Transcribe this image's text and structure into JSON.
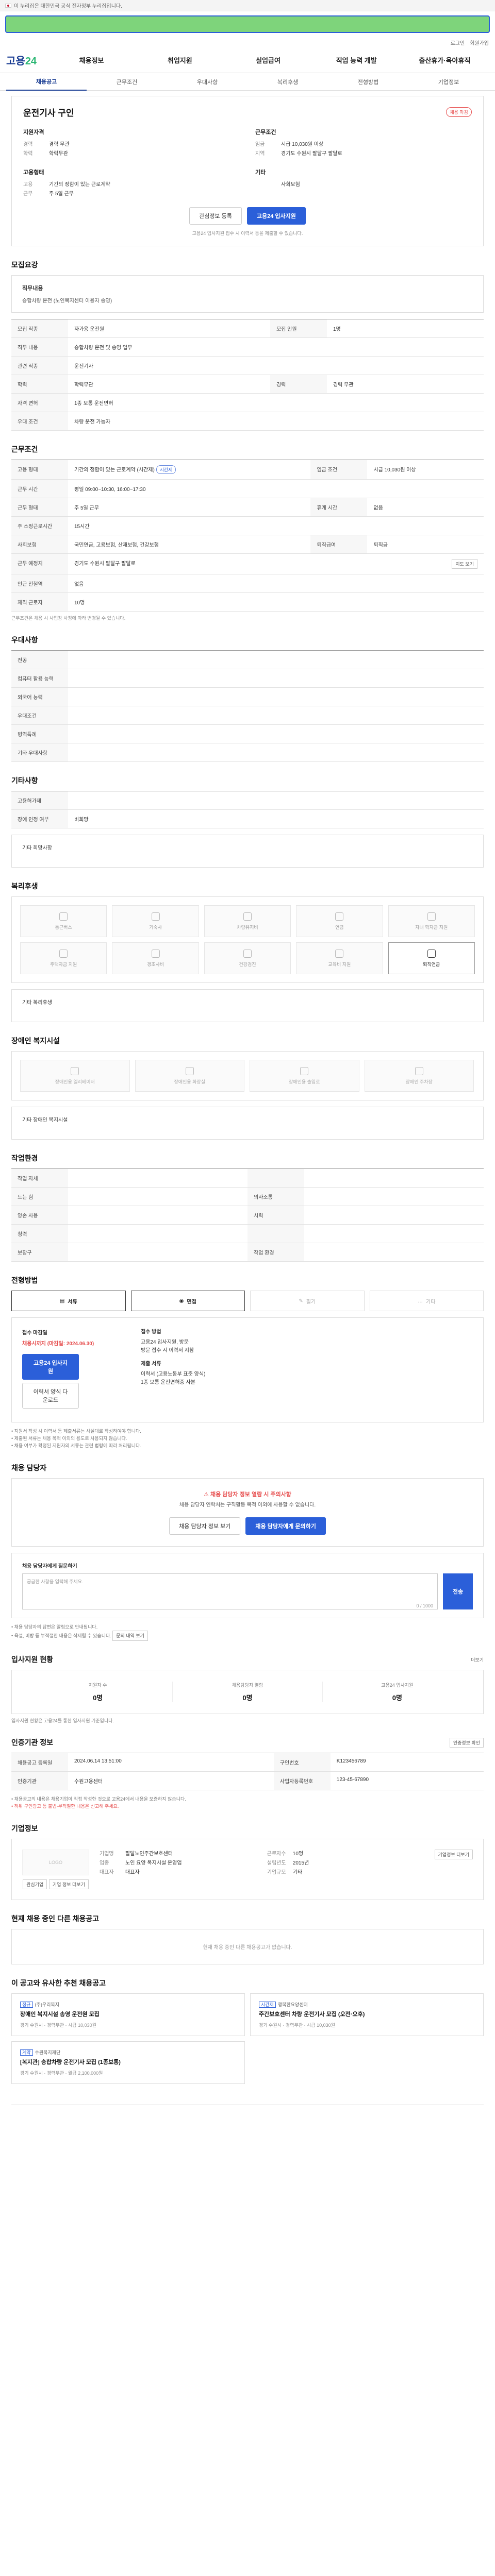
{
  "gov_bar": {
    "text": "이 누리집은 대한민국 공식 전자정부 누리집입니다."
  },
  "header": {
    "util": [
      "로그인",
      "회원가입"
    ],
    "logo_main": "고용",
    "logo_accent": "24",
    "gnb": [
      "채용정보",
      "취업지원",
      "실업급여",
      "직업 능력 개발",
      "출산휴가·육아휴직"
    ]
  },
  "tabs": [
    "채용공고",
    "근무조건",
    "우대사항",
    "복리후생",
    "전형방법",
    "기업정보"
  ],
  "job": {
    "title": "운전기사 구인",
    "badge": "채용 마감",
    "applicant_head": "지원자격",
    "applicant": [
      {
        "k": "경력",
        "v": "경력 무관"
      },
      {
        "k": "학력",
        "v": "학력무관"
      }
    ],
    "cond_head": "근무조건",
    "cond": [
      {
        "k": "임금",
        "v": "시급 10,030원 이상"
      },
      {
        "k": "지역",
        "v": "경기도 수원시 팔달구 팔달로"
      }
    ],
    "emp_head": "고용형태",
    "emp": [
      {
        "k": "고용",
        "v": "기간의 정함이 있는 근로계약"
      },
      {
        "k": "근무",
        "v": "주 5일 근무"
      }
    ],
    "etc_head": "기타",
    "etc": [
      {
        "k": "",
        "v": "사회보험"
      }
    ],
    "btn_bookmark": "관심정보 등록",
    "btn_apply": "고용24 입사지원",
    "note": "고용24 입사지원 접수 시 이력서 등을 제출할 수 있습니다."
  },
  "duties": {
    "title": "모집요강",
    "box_head": "직무내용",
    "box_text": "승합차량 운전 (노인복지센터 이용자 송영)",
    "rows": [
      {
        "k": "모집 직종",
        "v": "자가용 운전원"
      },
      {
        "k": "모집 인원",
        "v": "1명"
      },
      {
        "k": "직무 내용",
        "v": "승합차량 운전 및 송영 업무"
      },
      {
        "k": "관련 직종",
        "v": "운전기사"
      },
      {
        "k": "학력",
        "v": "학력무관"
      },
      {
        "k": "경력",
        "v": "경력 무관"
      },
      {
        "k": "자격 면허",
        "v": "1종 보통 운전면허"
      },
      {
        "k": "우대 조건",
        "v": "차량 운전 가능자"
      }
    ]
  },
  "work": {
    "title": "근무조건",
    "rows": [
      {
        "k": "고용 형태",
        "v": "기간의 정함이 있는 근로계약 (시간제)"
      },
      {
        "k": "임금 조건",
        "v": "시급 10,030원 이상"
      },
      {
        "k": "근무 시간",
        "v": "평일 09:00~10:30, 16:00~17:30"
      },
      {
        "k": "근무 형태",
        "v": "주 5일 근무"
      },
      {
        "k": "휴게 시간",
        "v": "없음"
      },
      {
        "k": "주 소정근로시간",
        "v": "15시간"
      },
      {
        "k": "사회보험",
        "v": "국민연금, 고용보험, 산재보험, 건강보험"
      },
      {
        "k": "퇴직급여",
        "v": "퇴직금"
      },
      {
        "k": "근무 예정지",
        "v": "경기도 수원시 팔달구 팔달로"
      },
      {
        "k": "인근 전철역",
        "v": "없음"
      },
      {
        "k": "재직 근로자",
        "v": "10명"
      }
    ],
    "pill": "시간제",
    "map_btn": "지도 보기",
    "note": "근무조건은 채용 시 사업장 사정에 따라 변경될 수 있습니다."
  },
  "prefer": {
    "title": "우대사항",
    "rows": [
      {
        "k": "전공",
        "v": ""
      },
      {
        "k": "컴퓨터 활용 능력",
        "v": ""
      },
      {
        "k": "외국어 능력",
        "v": ""
      },
      {
        "k": "우대조건",
        "v": ""
      },
      {
        "k": "병역특례",
        "v": ""
      },
      {
        "k": "기타 우대사항",
        "v": ""
      }
    ]
  },
  "other": {
    "title": "기타사항",
    "rows": [
      {
        "k": "고용허가제",
        "v": ""
      },
      {
        "k": "장애 인정 여부",
        "v": "비희망"
      }
    ],
    "etc_label": "기타 희망사항"
  },
  "welfare": {
    "title": "복리후생",
    "items": [
      "통근버스",
      "기숙사",
      "차량유지비",
      "연금",
      "자녀 학자금 지원",
      "주택자금 지원",
      "경조사비",
      "건강검진",
      "교육비 지원",
      "퇴직연금"
    ],
    "on_index": 9,
    "etc_label": "기타 복리후생"
  },
  "disabled": {
    "title": "장애인 복지시설",
    "items": [
      "장애인용 엘리베이터",
      "장애인용 화장실",
      "장애인용 출입로",
      "장애인 주차장"
    ],
    "etc_label": "기타 장애인 복지시설"
  },
  "env": {
    "title": "작업환경",
    "rows": [
      {
        "k": "작업 자세",
        "v": "",
        "k2": "",
        "v2": ""
      },
      {
        "k": "드는 힘",
        "v": "",
        "k2": "의사소통",
        "v2": ""
      },
      {
        "k": "양손 사용",
        "v": "",
        "k2": "시력",
        "v2": ""
      },
      {
        "k": "청력",
        "v": "",
        "k2": "",
        "v2": ""
      },
      {
        "k": "보장구",
        "v": "",
        "k2": "작업 환경",
        "v2": ""
      }
    ]
  },
  "method": {
    "title": "전형방법",
    "items": [
      "서류",
      "면접",
      "필기",
      "기타"
    ],
    "on": [
      true,
      true,
      false,
      false
    ],
    "deadline_head": "접수 마감일",
    "deadline": "채용시까지 (마감일: 2024.06.30)",
    "apply_head": "접수 방법",
    "apply_lines": [
      "고용24 입사지원, 방문",
      "방문 접수 시 이력서 지참"
    ],
    "docs_head": "제출 서류",
    "docs_lines": [
      "이력서 (고용노동부 표준 양식)",
      "1종 보통 운전면허증 사본"
    ],
    "btn_apply": "고용24 입사지원",
    "btn_resume": "이력서 양식 다운로드",
    "bullets": [
      "지원서 작성 시 이력서 등 제출서류는 사실대로 작성하여야 합니다.",
      "제출된 서류는 채용 목적 이외의 용도로 사용되지 않습니다.",
      "채용 여부가 확정된 지원자의 서류는 관련 법령에 따라 처리됩니다."
    ]
  },
  "contact": {
    "title": "채용 담당자",
    "alert": "채용 담당자 정보 열람 시 주의사항",
    "text": "채용 담당자 연락처는 구직활동 목적 이외에 사용할 수 없습니다.",
    "btn_a": "채용 담당자 정보 보기",
    "btn_b": "채용 담당자에게 문의하기",
    "inq_head": "채용 담당자에게 질문하기",
    "inq_placeholder": "궁금한 사항을 입력해 주세요.",
    "inq_count": "0 / 1000",
    "send": "전송",
    "bullets": [
      "채용 담당자의 답변은 알림으로 안내됩니다.",
      "욕설, 비방 등 부적절한 내용은 삭제될 수 있습니다."
    ],
    "mini": "문의 내역 보기"
  },
  "stats": {
    "title": "입사지원 현황",
    "more": "더보기",
    "items": [
      {
        "l": "지원자 수",
        "n": "0명"
      },
      {
        "l": "채용담당자 열람",
        "n": "0명"
      },
      {
        "l": "고용24 입사지원",
        "n": "0명"
      }
    ],
    "note": "입사지원 현황은 고용24를 통한 입사지원 기준입니다."
  },
  "meta": {
    "title": "인증기관 정보",
    "btn": "인증정보 확인",
    "rows": [
      {
        "k": "채용공고 등록일",
        "v": "2024.06.14 13:51:00",
        "k2": "구인번호",
        "v2": "K123456789"
      },
      {
        "k": "인증기관",
        "v": "수원고용센터",
        "k2": "사업자등록번호",
        "v2": "123-45-67890"
      }
    ],
    "notes": [
      "채용공고의 내용은 채용기업이 직접 작성한 것으로 고용24에서 내용을 보증하지 않습니다.",
      "허위 구인광고 등 불법·부적절한 내용은 신고해 주세요."
    ]
  },
  "company": {
    "title": "기업정보",
    "logo_text": "LOGO",
    "btn_a": "관심기업",
    "btn_b": "기업 정보 더보기",
    "rows_a": [
      {
        "k": "기업명",
        "v": "팔달노인주간보호센터"
      },
      {
        "k": "업종",
        "v": "노인 요양 복지시설 운영업"
      },
      {
        "k": "대표자",
        "v": "대표자"
      }
    ],
    "rows_b": [
      {
        "k": "근로자수",
        "v": "10명"
      },
      {
        "k": "설립년도",
        "v": "2015년"
      },
      {
        "k": "기업규모",
        "v": "기타"
      }
    ],
    "more": "기업정보 더보기"
  },
  "similar": {
    "title": "현재 채용 중인 다른 채용공고",
    "empty": "현재 채용 중인 다른 채용공고가 없습니다."
  },
  "rec": {
    "title": "이 공고와 유사한 추천 채용공고",
    "items": [
      {
        "co": "(주)우리복지",
        "tag": "정규",
        "t": "장애인 복지시설 송영 운전원 모집",
        "m": "경기 수원시 · 경력무관 · 시급 10,030원"
      },
      {
        "co": "행복한요양센터",
        "tag": "시간제",
        "t": "주간보호센터 차량 운전기사 모집 (오전·오후)",
        "m": "경기 수원시 · 경력무관 · 시급 10,030원"
      },
      {
        "co": "수원복지재단",
        "tag": "계약",
        "t": "[복지관] 승합차량 운전기사 모집 (1종보통)",
        "m": "경기 수원시 · 경력무관 · 월급 2,100,000원"
      }
    ]
  }
}
